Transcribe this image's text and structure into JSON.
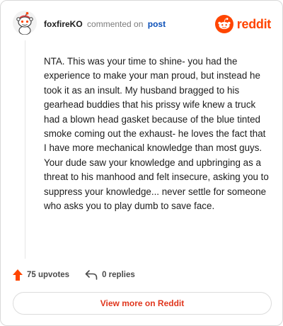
{
  "header": {
    "username": "foxfireKO",
    "commented_text": "commented on",
    "post_link": "post"
  },
  "brand": {
    "wordmark": "reddit",
    "color": "#ff4500",
    "icon": "reddit-snoo-icon"
  },
  "avatar": {
    "icon": "snoo-avatar-icon"
  },
  "comment": {
    "body": "NTA. This was your time to shine- you had the experience to make your man proud, but instead he took it as an insult. My husband bragged to his gearhead buddies that his prissy wife knew a truck had a blown head gasket because of the blue tinted smoke coming out the exhaust- he loves the fact that I have more mechanical knowledge than most guys. Your dude saw your knowledge and upbringing as a threat to his manhood and felt insecure, asking you to suppress your knowledge... never settle for someone who asks you to play dumb to save face."
  },
  "actions": {
    "upvotes": "75 upvotes",
    "replies": "0 replies",
    "upvote_icon": "upvote-arrow-icon",
    "reply_icon": "reply-arrow-icon",
    "upvote_color": "#ff4500"
  },
  "footer": {
    "view_more": "View more on Reddit",
    "link_color": "#e0361d"
  }
}
